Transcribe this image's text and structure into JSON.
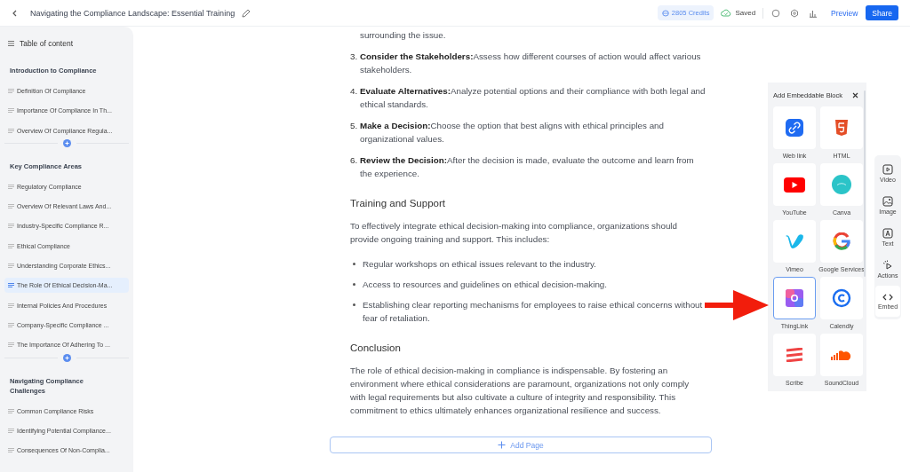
{
  "header": {
    "title": "Navigating the Compliance Landscape: Essential Training",
    "credits": "2805 Credits",
    "save_status": "Saved",
    "preview": "Preview",
    "share": "Share"
  },
  "sidebar": {
    "title": "Table of content",
    "sections": [
      {
        "heading": "Introduction to Compliance",
        "items": [
          {
            "label": "Definition Of Compliance",
            "selected": false
          },
          {
            "label": "Importance Of Compliance In Th...",
            "selected": false
          },
          {
            "label": "Overview Of Compliance Regula...",
            "selected": false
          }
        ]
      },
      {
        "heading": "Key Compliance Areas",
        "items": [
          {
            "label": "Regulatory Compliance",
            "selected": false
          },
          {
            "label": "Overview Of Relevant Laws And...",
            "selected": false
          },
          {
            "label": "Industry-Specific Compliance R...",
            "selected": false
          },
          {
            "label": "Ethical Compliance",
            "selected": false
          },
          {
            "label": "Understanding Corporate Ethics...",
            "selected": false
          },
          {
            "label": "The Role Of Ethical Decision-Ma...",
            "selected": true
          },
          {
            "label": "Internal Policies And Procedures",
            "selected": false
          },
          {
            "label": "Company-Specific Compliance ...",
            "selected": false
          },
          {
            "label": "The Importance Of Adhering To ...",
            "selected": false
          }
        ]
      },
      {
        "heading": "Navigating Compliance Challenges",
        "items": [
          {
            "label": "Common Compliance Risks",
            "selected": false
          },
          {
            "label": "Identifying Potential Compliance...",
            "selected": false
          },
          {
            "label": "Consequences Of Non-Complia...",
            "selected": false
          }
        ]
      }
    ]
  },
  "document": {
    "top_line": "surrounding the issue.",
    "steps": [
      {
        "number": "3.",
        "text": "**Consider the Stakeholders:**Assess how different courses of action would affect various stakeholders."
      },
      {
        "number": "4.",
        "text": "**Evaluate Alternatives:**Analyze potential options and their compliance with both legal and ethical standards."
      },
      {
        "number": "5.",
        "text": "**Make a Decision:**Choose the option that best aligns with ethical principles and organizational values."
      },
      {
        "number": "6.",
        "text": "**Review the Decision:**After the decision is made, evaluate the outcome and learn from the experience."
      }
    ],
    "sections": [
      {
        "heading": "Training and Support",
        "paragraph": "To effectively integrate ethical decision-making into compliance, organizations should provide ongoing training and support. This includes:",
        "bullets": [
          "Regular workshops on ethical issues relevant to the industry.",
          "Access to resources and guidelines on ethical decision-making.",
          "Establishing clear reporting mechanisms for employees to raise ethical concerns without fear of retaliation."
        ]
      },
      {
        "heading": "Conclusion",
        "paragraph": "The role of ethical decision-making in compliance is indispensable. By fostering an environment where ethical considerations are paramount, organizations not only comply with legal requirements but also cultivate a culture of integrity and responsibility. This commitment to ethics ultimately enhances organizational resilience and success."
      }
    ],
    "add_page": "Add Page"
  },
  "embed_panel": {
    "title": "Add Embeddable Block",
    "blocks": [
      {
        "label": "Web link",
        "selected": false
      },
      {
        "label": "HTML",
        "selected": false
      },
      {
        "label": "YouTube",
        "selected": false
      },
      {
        "label": "Canva",
        "selected": false
      },
      {
        "label": "Vimeo",
        "selected": false
      },
      {
        "label": "Google Services",
        "selected": false
      },
      {
        "label": "ThingLink",
        "selected": true
      },
      {
        "label": "Calendly",
        "selected": false
      },
      {
        "label": "Scribe",
        "selected": false
      },
      {
        "label": "SoundCloud",
        "selected": false
      }
    ]
  },
  "tools": [
    {
      "label": "Video",
      "selected": false
    },
    {
      "label": "Image",
      "selected": false
    },
    {
      "label": "Text",
      "selected": false
    },
    {
      "label": "Actions",
      "selected": false
    },
    {
      "label": "Embed",
      "selected": true
    }
  ]
}
